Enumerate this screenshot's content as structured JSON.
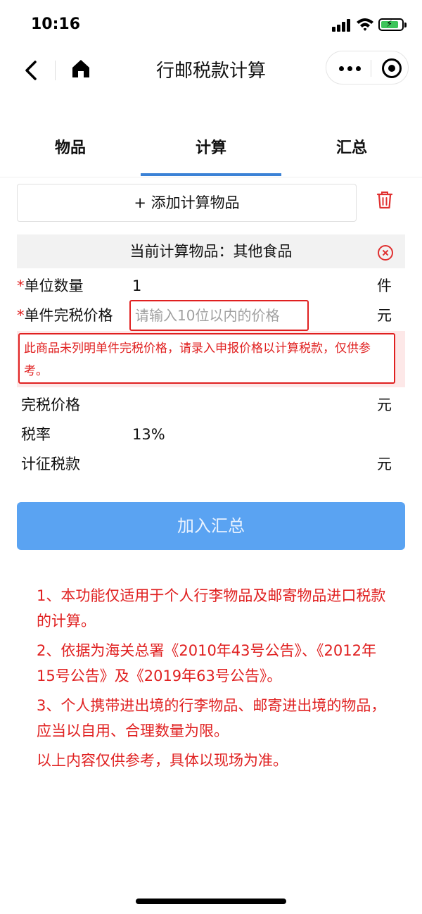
{
  "status": {
    "time": "10:16",
    "battery_color": "#3ec45a"
  },
  "nav": {
    "title": "行邮税款计算"
  },
  "tabs": [
    {
      "label": "物品"
    },
    {
      "label": "计算"
    },
    {
      "label": "汇总"
    }
  ],
  "active_tab": "计算",
  "add_item_label": "+ 添加计算物品",
  "current_item": {
    "label": "当前计算物品：其他食品"
  },
  "form": {
    "required_mark": "*",
    "quantity_label": "单位数量",
    "quantity_value": "1",
    "quantity_unit": "件",
    "unit_price_label": "单件完税价格",
    "unit_price_placeholder": "请输入10位以内的价格",
    "unit_price_unit": "元",
    "warning": "此商品未列明单件完税价格，请录入申报价格以计算税款，仅供参考。",
    "taxable_price_label": "完税价格",
    "taxable_price_unit": "元",
    "tax_rate_label": "税率",
    "tax_rate_value": "13%",
    "tax_amount_label": "计征税款",
    "tax_amount_unit": "元"
  },
  "add_summary_label": "加入汇总",
  "notes": [
    "1、本功能仅适用于个人行李物品及邮寄物品进口税款的计算。",
    "2、依据为海关总署《2010年43号公告》、《2012年15号公告》及《2019年63号公告》。",
    "3、个人携带进出境的行李物品、邮寄进出境的物品，应当以自用、合理数量为限。",
    "以上内容仅供参考，具体以现场为准。"
  ],
  "colors": {
    "accent": "#3b82d6",
    "button": "#5aa3f2",
    "warning": "#e02020"
  }
}
